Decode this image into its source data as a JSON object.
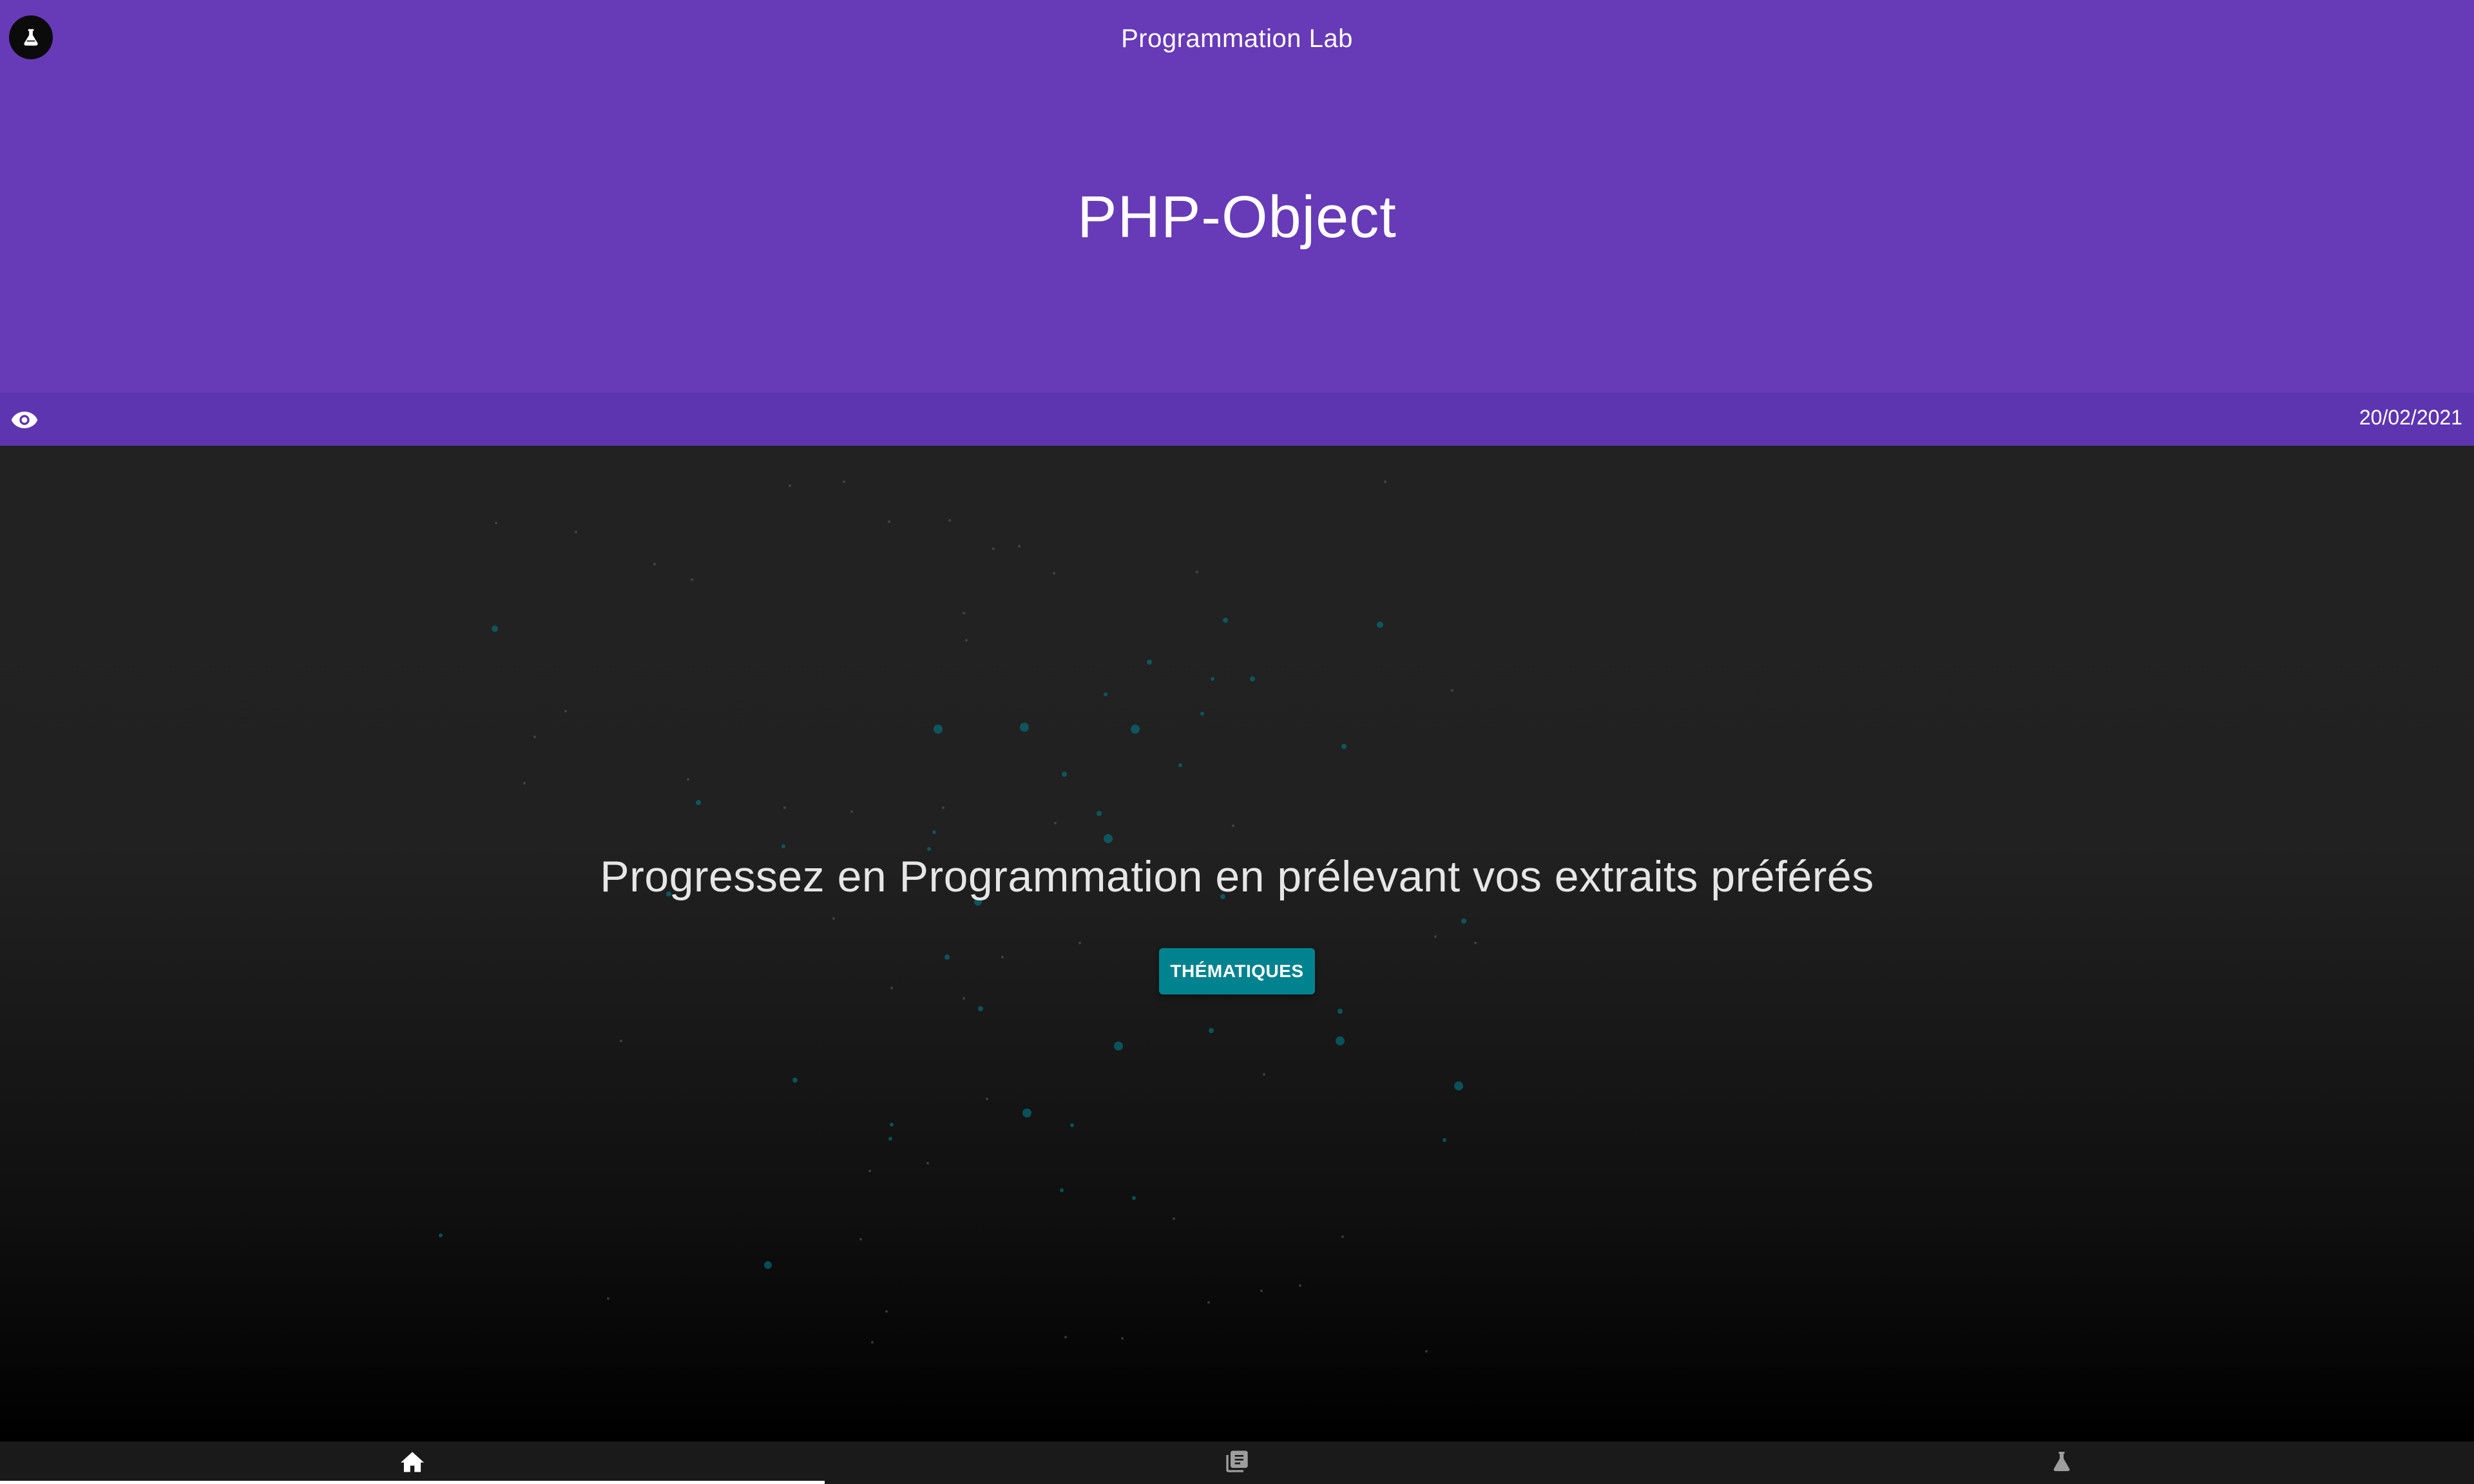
{
  "header": {
    "app_title": "Programmation Lab",
    "page_title": "PHP-Object",
    "logo_icon": "flask-icon",
    "background": "#673AB7"
  },
  "meta_bar": {
    "date": "20/02/2021",
    "views_icon": "eye-icon",
    "background": "#5E35B1"
  },
  "hero": {
    "tagline": "Progressez en Programmation en prélevant vos extraits préférés",
    "cta_label": "THÉMATIQUES",
    "cta_color": "#00838F",
    "particle_color": "#00838F"
  },
  "bottom_nav": {
    "tabs": [
      {
        "icon": "home-icon",
        "active": true
      },
      {
        "icon": "library-books-icon",
        "active": false
      },
      {
        "icon": "flask-icon",
        "active": false
      }
    ]
  }
}
